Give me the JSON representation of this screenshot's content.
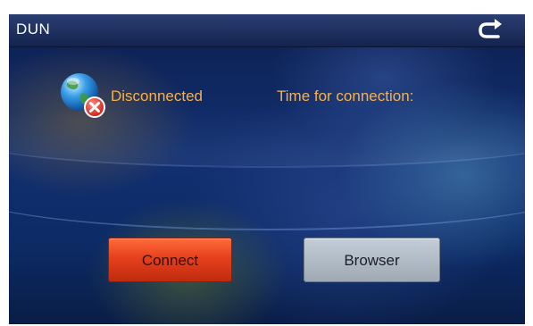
{
  "window": {
    "title": "DUN",
    "back_icon": "return-arrow-icon"
  },
  "status": {
    "icon": "globe-disconnected-icon",
    "text": "Disconnected"
  },
  "connection_time": {
    "label": "Time for connection:"
  },
  "buttons": {
    "connect_label": "Connect",
    "browser_label": "Browser"
  },
  "colors": {
    "accent_text": "#f7b14a",
    "connect_button": "#e6401c",
    "browser_button": "#b2bcc7"
  }
}
